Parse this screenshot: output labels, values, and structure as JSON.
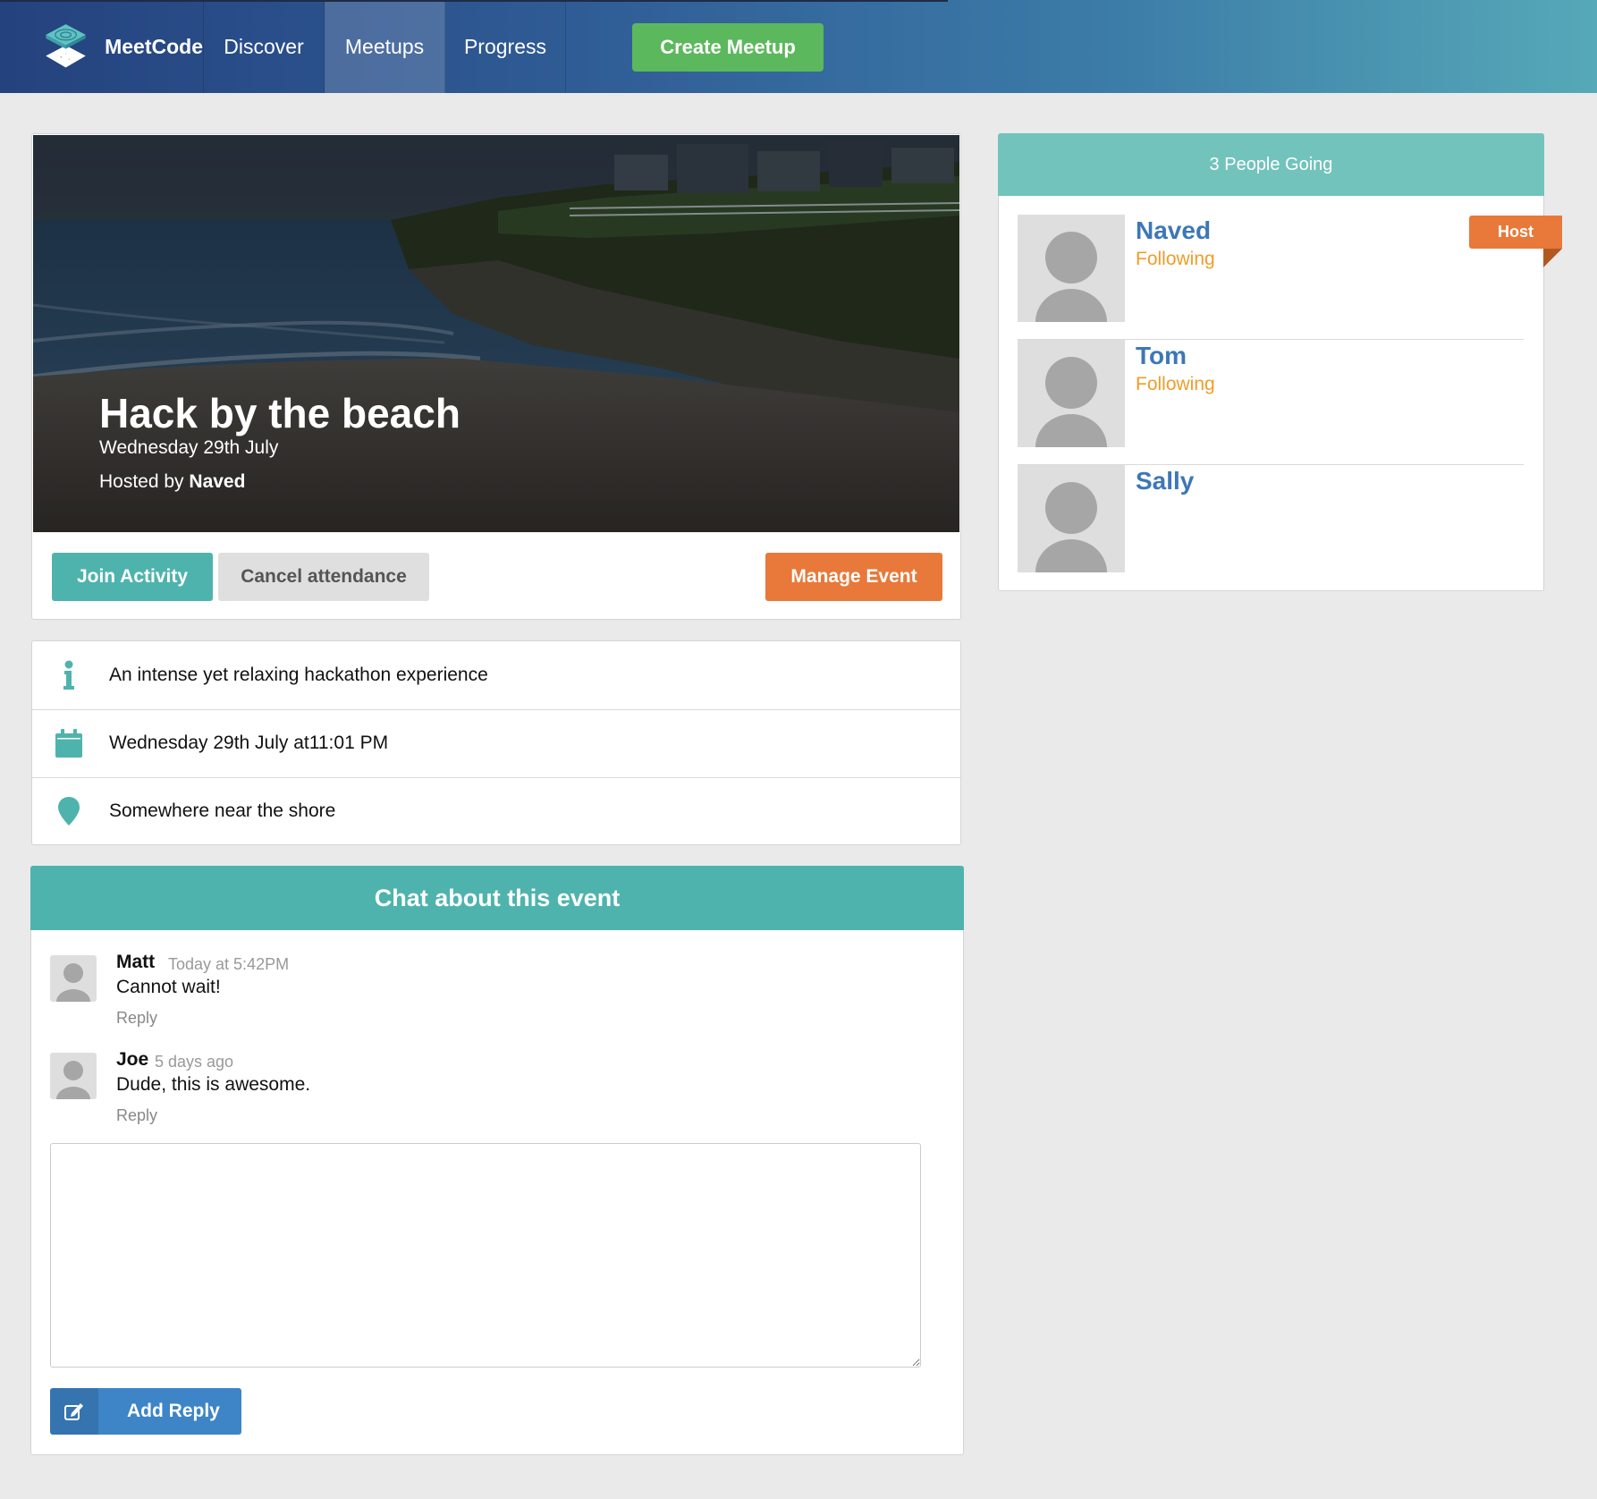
{
  "nav": {
    "brand": "MeetCode",
    "items": [
      {
        "label": "Discover"
      },
      {
        "label": "Meetups"
      },
      {
        "label": "Progress"
      }
    ],
    "create_label": "Create Meetup"
  },
  "event": {
    "title": "Hack by the beach",
    "date": "Wednesday 29th July",
    "hosted_by_prefix": "Hosted by",
    "host": "Naved",
    "actions": {
      "join": "Join Activity",
      "cancel": "Cancel attendance",
      "manage": "Manage Event"
    },
    "details": {
      "description": "An intense yet relaxing hackathon experience",
      "datetime": "Wednesday 29th July at11:01 PM",
      "location": "Somewhere near the shore"
    }
  },
  "chat": {
    "title": "Chat about this event",
    "comments": [
      {
        "author": "Matt",
        "time": "Today at 5:42PM",
        "text": "Cannot wait!",
        "reply": "Reply"
      },
      {
        "author": "Joe",
        "time": "5 days ago",
        "text": "Dude, this is awesome.",
        "reply": "Reply"
      }
    ],
    "reply_value": "",
    "add_reply_label": "Add Reply"
  },
  "attendees": {
    "title": "3 People Going",
    "host_badge": "Host",
    "people": [
      {
        "name": "Naved",
        "status": "Following"
      },
      {
        "name": "Tom",
        "status": "Following"
      },
      {
        "name": "Sally",
        "status": ""
      }
    ]
  },
  "colors": {
    "teal": "#4fb3ad",
    "teal_light": "#72c3bb",
    "green": "#5cb85c",
    "orange": "#e8793a",
    "blue": "#3d85c6",
    "name_blue": "#3d77b8",
    "following_orange": "#ef9d2a"
  },
  "icons": [
    "logo-icon",
    "info-icon",
    "calendar-icon",
    "map-pin-icon",
    "edit-icon",
    "avatar-icon"
  ]
}
